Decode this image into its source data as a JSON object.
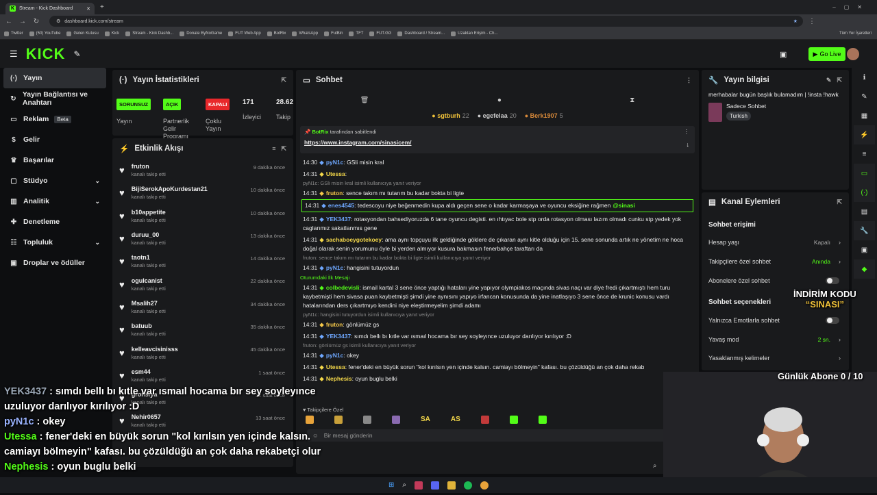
{
  "browser": {
    "tab_title": "Stream - Kick Dashboard",
    "new_tab": "+",
    "url": "dashboard.kick.com/stream",
    "bookmarks": [
      "Twitter",
      "(50) YouTube",
      "Gelen Kutusu",
      "Kick",
      "Stream - Kick Dashb...",
      "Donate ByNoGame",
      "FUT Web App",
      "BotRix",
      "WhatsApp",
      "FutBin",
      "TFT",
      "FUT.GG",
      "Dashboard / Stream...",
      "Uzaktan Erişim - Ch..."
    ],
    "all_bookmarks": "Tüm Yer İşaretleri"
  },
  "header": {
    "logo": "KICK",
    "go_live": "Go Live"
  },
  "sidebar": {
    "items": [
      {
        "label": "Yayın"
      },
      {
        "label": "Yayın Bağlantısı ve Anahtarı"
      },
      {
        "label": "Reklam",
        "badge": "Beta"
      },
      {
        "label": "Gelir"
      },
      {
        "label": "Başarılar"
      },
      {
        "label": "Stüdyo"
      },
      {
        "label": "Analitik"
      },
      {
        "label": "Denetleme"
      },
      {
        "label": "Topluluk"
      },
      {
        "label": "Droplar ve ödüller"
      }
    ]
  },
  "stats": {
    "title": "Yayın İstatistikleri",
    "stream_badge": "SORUNSUZ",
    "stream_label": "Yayın",
    "partner_badge": "AÇIK",
    "partner_label": "Partnerlik Gelir Programı",
    "multi_badge": "KAPALI",
    "multi_label": "Çoklu Yayın",
    "viewers": "171",
    "viewers_label": "İzleyici",
    "followers": "28.62",
    "followers_label": "Takip"
  },
  "activity": {
    "title": "Etkinlik Akışı",
    "items": [
      {
        "name": "fruton",
        "sub": "kanalı takip etti",
        "time": "9 dakika önce"
      },
      {
        "name": "BijiSerokApoKurdestan21",
        "sub": "kanalı takip etti",
        "time": "10 dakika önce"
      },
      {
        "name": "b10appetite",
        "sub": "kanalı takip etti",
        "time": "10 dakika önce"
      },
      {
        "name": "duruu_00",
        "sub": "kanalı takip etti",
        "time": "13 dakika önce"
      },
      {
        "name": "taotn1",
        "sub": "kanalı takip etti",
        "time": "14 dakika önce"
      },
      {
        "name": "ogulcanist",
        "sub": "kanalı takip etti",
        "time": "22 dakika önce"
      },
      {
        "name": "Msalih27",
        "sub": "kanalı takip etti",
        "time": "34 dakika önce"
      },
      {
        "name": "batuub",
        "sub": "kanalı takip etti",
        "time": "35 dakika önce"
      },
      {
        "name": "kelleavcisinisss",
        "sub": "kanalı takip etti",
        "time": "45 dakika önce"
      },
      {
        "name": "esm44",
        "sub": "kanalı takip etti",
        "time": "1 saat önce"
      },
      {
        "name": "gronsiya",
        "sub": "kanalı takip etti",
        "time": "12 saat önce"
      },
      {
        "name": "Nehir0657",
        "sub": "kanalı takip etti",
        "time": "13 saat önce"
      }
    ]
  },
  "chat": {
    "title": "Sohbet",
    "top": [
      {
        "name": "sgtburh",
        "count": "22"
      },
      {
        "name": "egefelaa",
        "count": "20"
      },
      {
        "name": "Berk1907",
        "count": "5"
      }
    ],
    "pinned_by": "BotRix",
    "pinned_text": "tarafından sabitlendi",
    "pinned_link": "https://www.instagram.com/sinasicem/",
    "messages": [
      {
        "time": "14:30",
        "user": "pyN1c",
        "color": "#6fa8ff",
        "text": "GSli misin kral"
      },
      {
        "time": "14:31",
        "user": "Utessa",
        "color": "#f5d94a",
        "text": ""
      },
      {
        "reply": "pyN1c: GSli misin kral isimli kullanıcıya yanıt veriyor"
      },
      {
        "time": "14:31",
        "user": "fruton",
        "color": "#f5c84a",
        "text": "sence takım mı tutarım bu kadar bokta bi ligte"
      },
      {
        "time": "14:31",
        "user": "enes4545",
        "color": "#6fa8ff",
        "text": "tedescoyu niye beğenmedin kupa aldı geçen sene o kadar karmaşaya ve oyuncu eksiğine rağmen",
        "mention": "@sinasi"
      },
      {
        "time": "14:31",
        "user": "YEK3437",
        "color": "#6fa8ff",
        "text": "rotasyondan bahsediyoruzda 6 tane oyuncu degisti. en ıhtıyac bole stp orda rotasyon olması lazım olmadı cunku stp yedek yok caglarımız sakatlanmıs gene"
      },
      {
        "time": "14:31",
        "user": "sachaboeygotekoey",
        "color": "#f5d94a",
        "text": "ama aynı topçuyu ilk geldiğinde göklere de çıkaran aynı kitle olduğu için 15. sene sonunda artık ne yönetim ne hoca doğal olarak senin yorumunu öyle bi yerden almıyor kusura bakmasın fenerbahçe taraftarı da"
      },
      {
        "reply": "fruton: sence takım mı tutarım bu kadar bokta bi ligte isimli kullanıcıya yanıt veriyor"
      },
      {
        "time": "14:31",
        "user": "pyN1c",
        "color": "#6fa8ff",
        "text": "hangisini tutuyordun"
      },
      {
        "first": "Oturumdaki İlk Mesajı"
      },
      {
        "time": "14:31",
        "user": "colbedevisli",
        "color": "#53fc18",
        "text": "ismail kartal 3 sene önce yaptığı hataları yine yapıyor olympiakos maçında sivas naçı var diye fredi çıkartmıştı hem turu kaybetmişti hem sivasa puan kaybetmişti şimdi yine aynısını yapıyo irfancan konusunda da yine inatlaşıyo 3 sene önce de krunic konusu vardı hatalarından ders çıkartmıyo kendini niye eleştirmeyelim şimdi adamı"
      },
      {
        "reply": "pyN1c: hangisini tutuyordun isimli kullanıcıya yanıt veriyor"
      },
      {
        "time": "14:31",
        "user": "fruton",
        "color": "#f5c84a",
        "text": "gönlümüz gs"
      },
      {
        "time": "14:31",
        "user": "YEK3437",
        "color": "#6fa8ff",
        "text": "sımdı bellı bı kıtle var ısmaıl hocama bır sey soyleyınce uzuluyor darılıyor kırılıyor :D"
      },
      {
        "reply": "fruton: gönlümüz gs isimli kullanıcıya yanıt veriyor"
      },
      {
        "time": "14:31",
        "user": "pyN1c",
        "color": "#6fa8ff",
        "text": "okey"
      },
      {
        "time": "14:31",
        "user": "Utessa",
        "color": "#f5d94a",
        "text": "fener'deki en büyük sorun \"kol kırılsın yen içinde kalsın. camiayı bölmeyin\" kafası. bu çözüldüğü an çok daha rekab"
      },
      {
        "time": "14:31",
        "user": "Nephesis",
        "color": "#f5d94a",
        "text": "oyun buglu belki"
      }
    ],
    "subs_only_label": "Takipçilere Özel",
    "emote_labels": [
      "SA",
      "AS"
    ],
    "input_placeholder": "Bir mesaj gönderin"
  },
  "info": {
    "title": "Yayın bilgisi",
    "stream_title": "merhabalar bugün başlık bulamadım | !insta !hawk",
    "category": "Sadece Sohbet",
    "tag": "Turkish"
  },
  "actions": {
    "title": "Kanal Eylemleri",
    "access_head": "Sohbet erişimi",
    "account_age": "Hesap yaşı",
    "account_age_val": "Kapalı",
    "followers_only": "Takipçilere özel sohbet",
    "followers_only_val": "Anında",
    "subs_only": "Abonelere özel sohbet",
    "options_head": "Sohbet seçenekleri",
    "emote_only": "Yalnızca Emotlarla sohbet",
    "slow_mode": "Yavaş mod",
    "slow_mode_val": "2 sn.",
    "banned_words": "Yasaklanmış kelimeler"
  },
  "overlay": {
    "promo_line1": "İNDİRİM KODU",
    "promo_line2": "“SINASI”",
    "sub_goal": "Günlük Abone 0 / 10",
    "lines": [
      {
        "user": "YEK3437",
        "color": "#9aa6b5",
        "text": " : sımdı bellı bı kıtle var ısmaıl hocama bır sey soyleyınce"
      },
      {
        "user": "",
        "color": "#ffffff",
        "text": "uzuluyor darılıyor kırılıyor :D"
      },
      {
        "user": "pyN1c",
        "color": "#9ab3ff",
        "text": " : okey"
      },
      {
        "user": "Utessa",
        "color": "#53fc18",
        "text": " : fener'deki en büyük sorun \"kol kırılsın yen içinde kalsın."
      },
      {
        "user": "",
        "color": "#ffffff",
        "text": "camiayı bölmeyin\" kafası. bu çözüldüğü an çok daha rekabetçi olur"
      },
      {
        "user": "Nephesis",
        "color": "#53fc18",
        "text": " : oyun buglu belki"
      }
    ]
  }
}
